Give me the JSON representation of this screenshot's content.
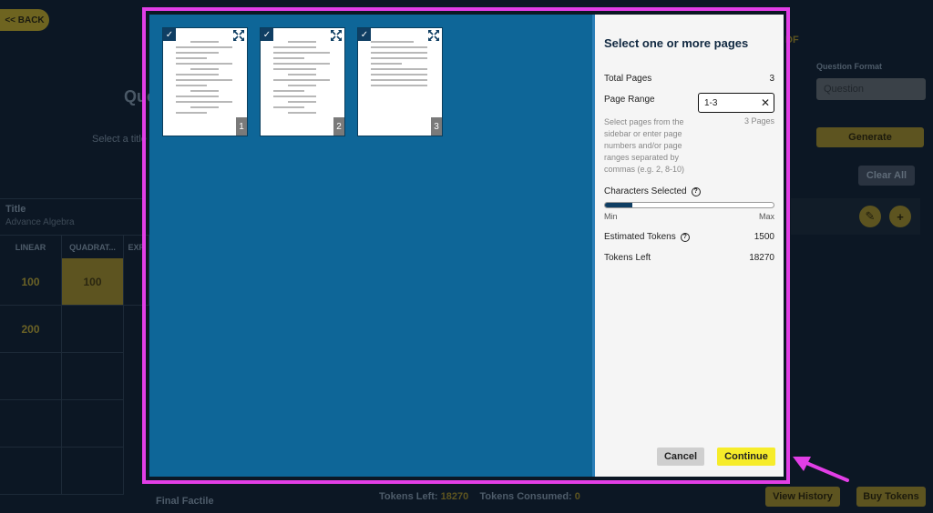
{
  "background": {
    "back_label": "<< BACK",
    "heading": "Que",
    "subtitle": "Select a title",
    "table": {
      "title_header": "Title",
      "title_value": "Advance Algebra",
      "columns": [
        "LINEAR",
        "QUADRAT...",
        "EXP"
      ],
      "rows": [
        [
          "100",
          "100",
          ""
        ],
        [
          "200",
          "",
          ""
        ]
      ]
    },
    "footer_label": "Final Factile",
    "tokens_left_label": "Tokens Left:",
    "tokens_left_value": "18270",
    "tokens_consumed_label": "Tokens Consumed:",
    "tokens_consumed_value": "0",
    "pdf_label": "DF",
    "question_format_label": "Question Format",
    "question_format_value": "Question",
    "generate_label": "Generate",
    "clear_all_label": "Clear All",
    "view_history_label": "View History",
    "buy_tokens_label": "Buy Tokens"
  },
  "modal": {
    "title": "Select one or more pages",
    "total_pages_label": "Total Pages",
    "total_pages_value": "3",
    "page_range_label": "Page Range",
    "page_range_value": "1-3",
    "pages_count": "3 Pages",
    "hint": "Select pages from the sidebar or enter page numbers and/or page ranges separated by commas (e.g. 2, 8-10)",
    "characters_label": "Characters Selected",
    "characters_fraction": 0.16,
    "min_label": "Min",
    "max_label": "Max",
    "estimated_tokens_label": "Estimated Tokens",
    "estimated_tokens_value": "1500",
    "tokens_left_label": "Tokens Left",
    "tokens_left_value": "18270",
    "cancel_label": "Cancel",
    "continue_label": "Continue",
    "thumbnails": [
      {
        "page": "1",
        "selected": true
      },
      {
        "page": "2",
        "selected": true
      },
      {
        "page": "3",
        "selected": true
      }
    ]
  },
  "colors": {
    "highlight": "#e23ee6",
    "accent": "#f6ec2a",
    "modal_bg": "#0e6698"
  }
}
